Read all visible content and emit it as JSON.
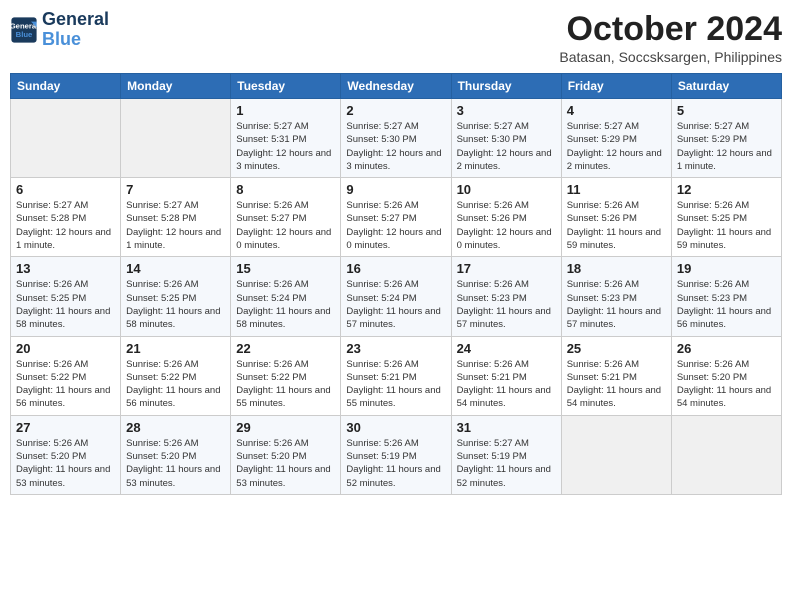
{
  "logo": {
    "line1": "General",
    "line2": "Blue"
  },
  "title": "October 2024",
  "subtitle": "Batasan, Soccsksargen, Philippines",
  "headers": [
    "Sunday",
    "Monday",
    "Tuesday",
    "Wednesday",
    "Thursday",
    "Friday",
    "Saturday"
  ],
  "weeks": [
    [
      {
        "day": "",
        "detail": ""
      },
      {
        "day": "",
        "detail": ""
      },
      {
        "day": "1",
        "detail": "Sunrise: 5:27 AM\nSunset: 5:31 PM\nDaylight: 12 hours and 3 minutes."
      },
      {
        "day": "2",
        "detail": "Sunrise: 5:27 AM\nSunset: 5:30 PM\nDaylight: 12 hours and 3 minutes."
      },
      {
        "day": "3",
        "detail": "Sunrise: 5:27 AM\nSunset: 5:30 PM\nDaylight: 12 hours and 2 minutes."
      },
      {
        "day": "4",
        "detail": "Sunrise: 5:27 AM\nSunset: 5:29 PM\nDaylight: 12 hours and 2 minutes."
      },
      {
        "day": "5",
        "detail": "Sunrise: 5:27 AM\nSunset: 5:29 PM\nDaylight: 12 hours and 1 minute."
      }
    ],
    [
      {
        "day": "6",
        "detail": "Sunrise: 5:27 AM\nSunset: 5:28 PM\nDaylight: 12 hours and 1 minute."
      },
      {
        "day": "7",
        "detail": "Sunrise: 5:27 AM\nSunset: 5:28 PM\nDaylight: 12 hours and 1 minute."
      },
      {
        "day": "8",
        "detail": "Sunrise: 5:26 AM\nSunset: 5:27 PM\nDaylight: 12 hours and 0 minutes."
      },
      {
        "day": "9",
        "detail": "Sunrise: 5:26 AM\nSunset: 5:27 PM\nDaylight: 12 hours and 0 minutes."
      },
      {
        "day": "10",
        "detail": "Sunrise: 5:26 AM\nSunset: 5:26 PM\nDaylight: 12 hours and 0 minutes."
      },
      {
        "day": "11",
        "detail": "Sunrise: 5:26 AM\nSunset: 5:26 PM\nDaylight: 11 hours and 59 minutes."
      },
      {
        "day": "12",
        "detail": "Sunrise: 5:26 AM\nSunset: 5:25 PM\nDaylight: 11 hours and 59 minutes."
      }
    ],
    [
      {
        "day": "13",
        "detail": "Sunrise: 5:26 AM\nSunset: 5:25 PM\nDaylight: 11 hours and 58 minutes."
      },
      {
        "day": "14",
        "detail": "Sunrise: 5:26 AM\nSunset: 5:25 PM\nDaylight: 11 hours and 58 minutes."
      },
      {
        "day": "15",
        "detail": "Sunrise: 5:26 AM\nSunset: 5:24 PM\nDaylight: 11 hours and 58 minutes."
      },
      {
        "day": "16",
        "detail": "Sunrise: 5:26 AM\nSunset: 5:24 PM\nDaylight: 11 hours and 57 minutes."
      },
      {
        "day": "17",
        "detail": "Sunrise: 5:26 AM\nSunset: 5:23 PM\nDaylight: 11 hours and 57 minutes."
      },
      {
        "day": "18",
        "detail": "Sunrise: 5:26 AM\nSunset: 5:23 PM\nDaylight: 11 hours and 57 minutes."
      },
      {
        "day": "19",
        "detail": "Sunrise: 5:26 AM\nSunset: 5:23 PM\nDaylight: 11 hours and 56 minutes."
      }
    ],
    [
      {
        "day": "20",
        "detail": "Sunrise: 5:26 AM\nSunset: 5:22 PM\nDaylight: 11 hours and 56 minutes."
      },
      {
        "day": "21",
        "detail": "Sunrise: 5:26 AM\nSunset: 5:22 PM\nDaylight: 11 hours and 56 minutes."
      },
      {
        "day": "22",
        "detail": "Sunrise: 5:26 AM\nSunset: 5:22 PM\nDaylight: 11 hours and 55 minutes."
      },
      {
        "day": "23",
        "detail": "Sunrise: 5:26 AM\nSunset: 5:21 PM\nDaylight: 11 hours and 55 minutes."
      },
      {
        "day": "24",
        "detail": "Sunrise: 5:26 AM\nSunset: 5:21 PM\nDaylight: 11 hours and 54 minutes."
      },
      {
        "day": "25",
        "detail": "Sunrise: 5:26 AM\nSunset: 5:21 PM\nDaylight: 11 hours and 54 minutes."
      },
      {
        "day": "26",
        "detail": "Sunrise: 5:26 AM\nSunset: 5:20 PM\nDaylight: 11 hours and 54 minutes."
      }
    ],
    [
      {
        "day": "27",
        "detail": "Sunrise: 5:26 AM\nSunset: 5:20 PM\nDaylight: 11 hours and 53 minutes."
      },
      {
        "day": "28",
        "detail": "Sunrise: 5:26 AM\nSunset: 5:20 PM\nDaylight: 11 hours and 53 minutes."
      },
      {
        "day": "29",
        "detail": "Sunrise: 5:26 AM\nSunset: 5:20 PM\nDaylight: 11 hours and 53 minutes."
      },
      {
        "day": "30",
        "detail": "Sunrise: 5:26 AM\nSunset: 5:19 PM\nDaylight: 11 hours and 52 minutes."
      },
      {
        "day": "31",
        "detail": "Sunrise: 5:27 AM\nSunset: 5:19 PM\nDaylight: 11 hours and 52 minutes."
      },
      {
        "day": "",
        "detail": ""
      },
      {
        "day": "",
        "detail": ""
      }
    ]
  ]
}
